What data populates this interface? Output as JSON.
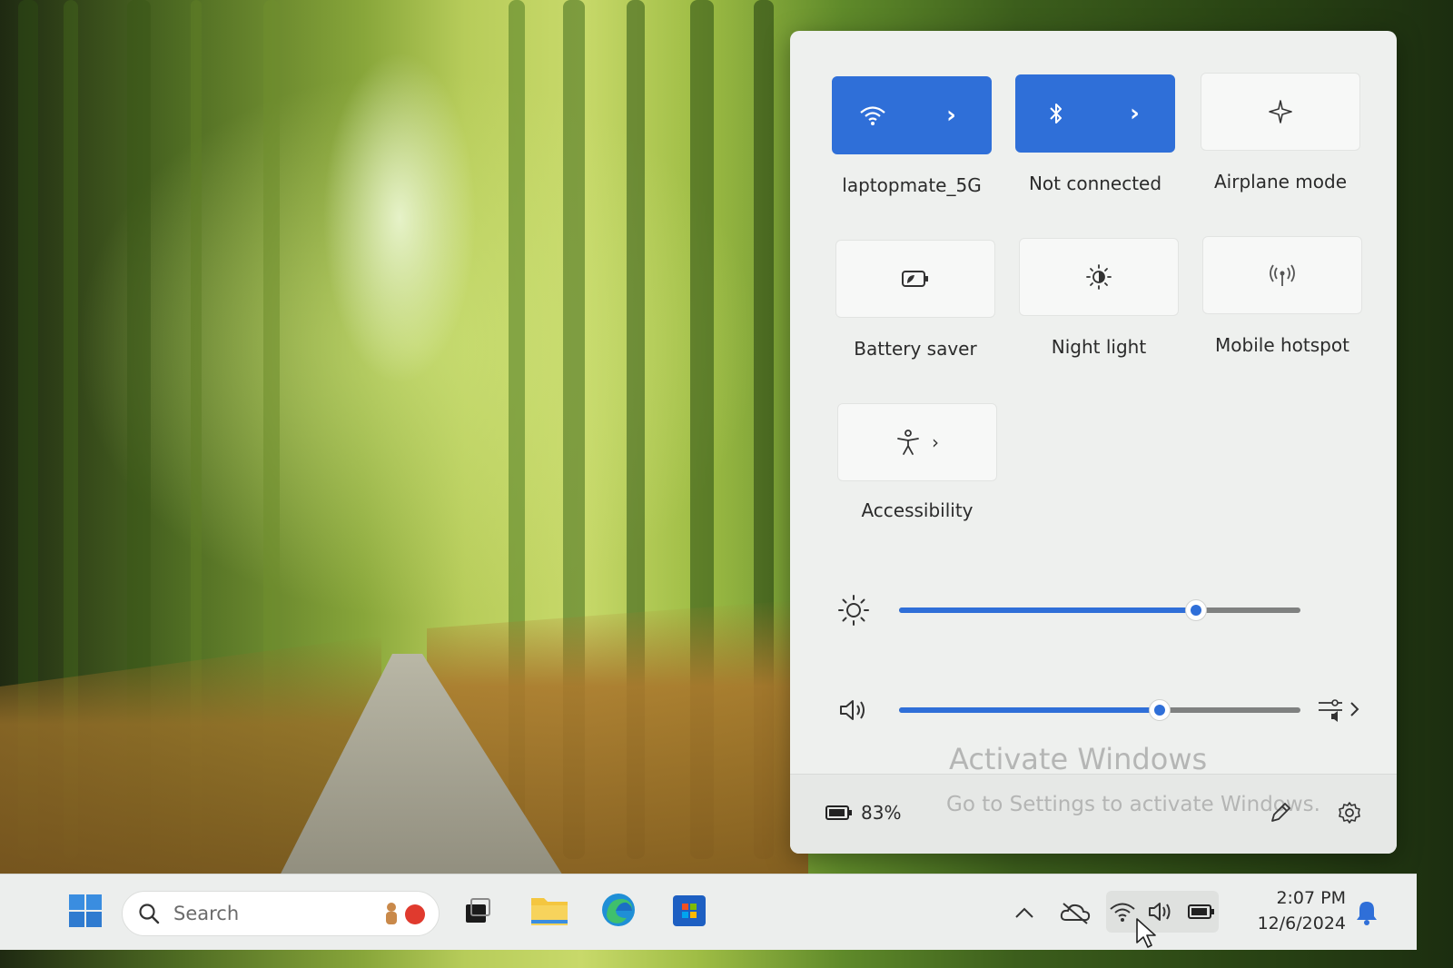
{
  "quick_settings": {
    "tiles": [
      {
        "label": "laptopmate_5G",
        "icon": "wifi-icon",
        "active": true,
        "has_arrow": true
      },
      {
        "label": "Not connected",
        "icon": "bluetooth-icon",
        "active": true,
        "has_arrow": true
      },
      {
        "label": "Airplane mode",
        "icon": "airplane-icon",
        "active": false,
        "has_arrow": false
      },
      {
        "label": "Battery saver",
        "icon": "battery-saver-icon",
        "active": false,
        "has_arrow": false
      },
      {
        "label": "Night light",
        "icon": "night-light-icon",
        "active": false,
        "has_arrow": false
      },
      {
        "label": "Mobile hotspot",
        "icon": "mobile-hotspot-icon",
        "active": false,
        "has_arrow": false
      },
      {
        "label": "Accessibility",
        "icon": "accessibility-icon",
        "active": false,
        "has_arrow": true
      }
    ],
    "brightness": {
      "icon": "brightness-icon",
      "level_fraction": 0.74
    },
    "volume": {
      "icon": "speaker-icon",
      "level_fraction": 0.65,
      "mixer_icon": "sound-mixer-icon"
    },
    "footer": {
      "battery_percent": "83%",
      "battery_icon": "battery-icon",
      "edit_icon": "pencil-icon",
      "settings_icon": "gear-icon"
    },
    "watermark": {
      "title": "Activate Windows",
      "subtitle": "Go to Settings to activate Windows."
    }
  },
  "taskbar": {
    "search_placeholder": "Search",
    "apps": [
      "start-icon",
      "task-view-icon",
      "file-explorer-icon",
      "edge-icon",
      "store-icon"
    ],
    "tray_icons": [
      "chevron-up-icon",
      "onedrive-icon",
      "wifi-icon",
      "speaker-icon",
      "battery-icon"
    ],
    "time": "2:07 PM",
    "date": "12/6/2024",
    "notification_icon": "bell-icon"
  },
  "colors": {
    "accent": "#2f6fd8",
    "panel_bg": "#eef0ee",
    "taskbar_bg": "#eceeed"
  }
}
